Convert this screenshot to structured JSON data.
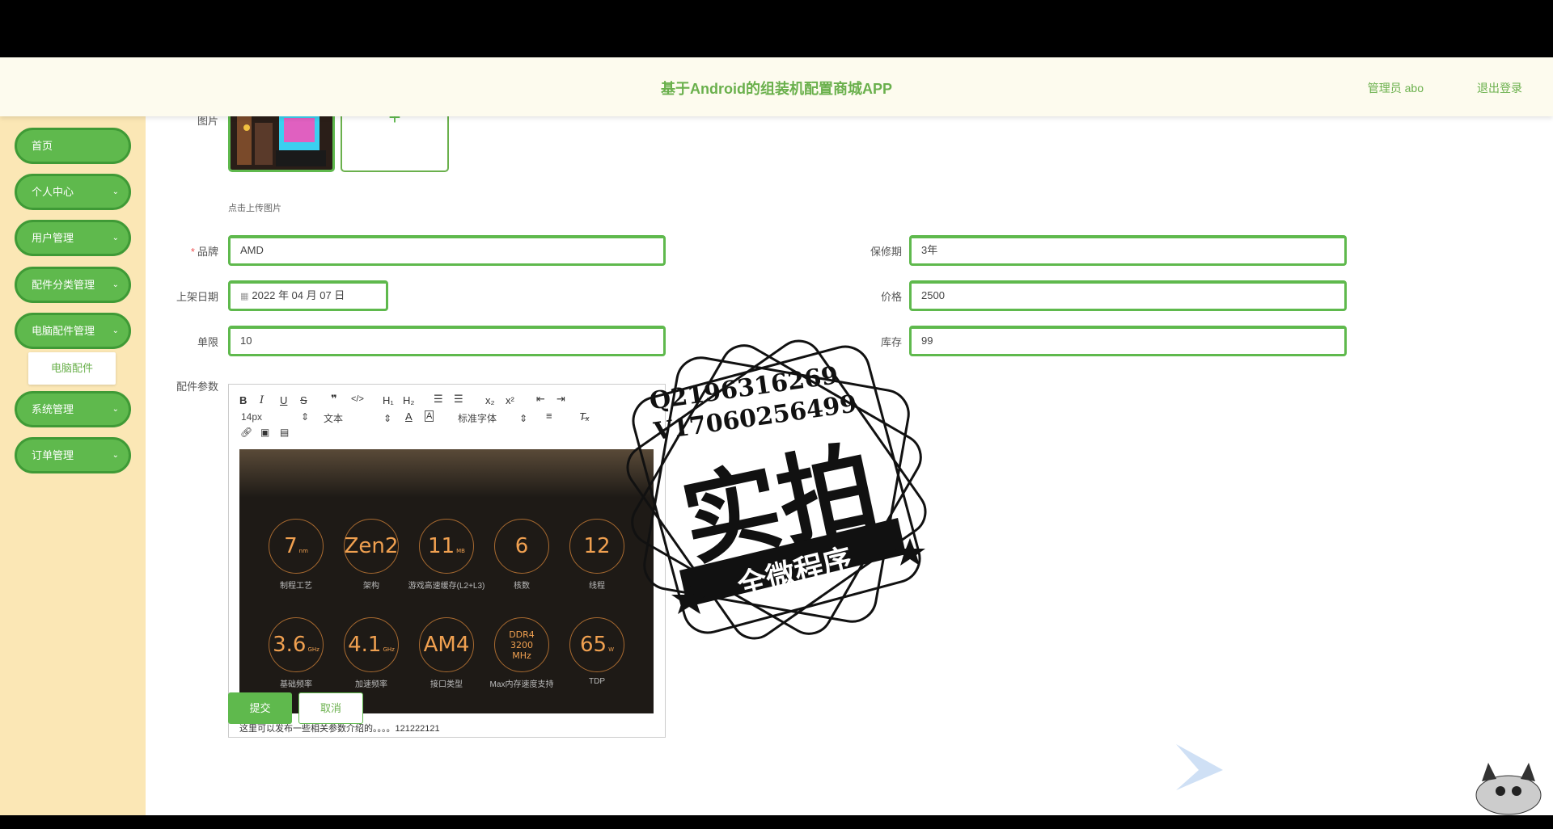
{
  "app": {
    "title": "基于Android的组装机配置商城APP",
    "user": "管理员 abo",
    "logout": "退出登录"
  },
  "sidebar": {
    "items": [
      {
        "label": "首页"
      },
      {
        "label": "个人中心"
      },
      {
        "label": "用户管理"
      },
      {
        "label": "配件分类管理"
      },
      {
        "label": "电脑配件管理"
      },
      {
        "label": "系统管理"
      },
      {
        "label": "订单管理"
      }
    ],
    "sub_item": "电脑配件",
    "chevron": "⌄"
  },
  "form": {
    "image_label": "图片",
    "upload_hint": "点击上传图片",
    "upload_plus": "+",
    "brand_label": "品牌",
    "required_mark": "*",
    "brand_value": "AMD",
    "warranty_label": "保修期",
    "warranty_value": "3年",
    "date_label": "上架日期",
    "date_value": "2022 年 04 月 07 日",
    "price_label": "价格",
    "price_value": "2500",
    "limit_label": "单限",
    "limit_value": "10",
    "stock_label": "库存",
    "stock_value": "99",
    "params_label": "配件参数"
  },
  "editor": {
    "font_size": "14px",
    "format": "文本",
    "font_family": "标准字体",
    "content_text": "这里可以发布一些相关参数介绍的。。。。121222121",
    "specs": [
      {
        "value": "7",
        "unit": "nm",
        "label": "制程工艺"
      },
      {
        "value": "Zen2",
        "unit": "",
        "label": "架构"
      },
      {
        "value": "11",
        "unit": "MB",
        "label": "游戏高速缓存(L2+L3)"
      },
      {
        "value": "6",
        "unit": "",
        "label": "核数"
      },
      {
        "value": "12",
        "unit": "",
        "label": "线程"
      },
      {
        "value": "3.6",
        "unit": "GHz",
        "label": "基础频率"
      },
      {
        "value": "4.1",
        "unit": "GHz",
        "label": "加速频率"
      },
      {
        "value": "AM4",
        "unit": "",
        "label": "接口类型"
      },
      {
        "value": "DDR4 3200 MHz",
        "unit": "",
        "label": "Max内存速度支持"
      },
      {
        "value": "65",
        "unit": "W",
        "label": "TDP"
      }
    ]
  },
  "buttons": {
    "submit": "提交",
    "cancel": "取消"
  },
  "watermark": {
    "line1": "Q2196316269",
    "line2": "V17060256499",
    "big": "实拍",
    "banner": "全微程序"
  },
  "colors": {
    "accent": "#5fb94d",
    "sidebar_bg": "#fbe7b5",
    "topbar_bg": "#fdfbee"
  }
}
